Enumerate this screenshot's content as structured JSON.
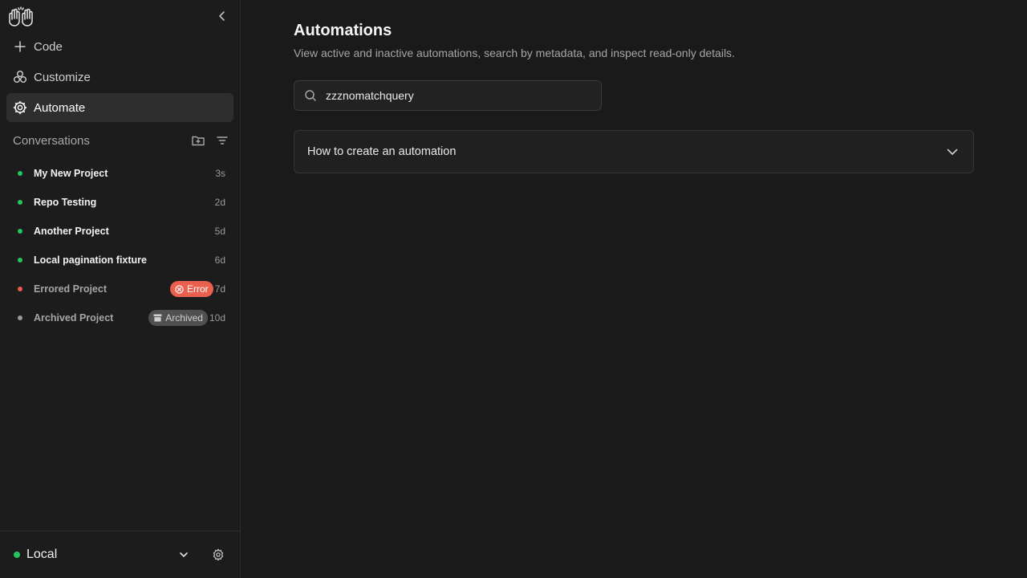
{
  "sidebar": {
    "nav": [
      {
        "label": "Code",
        "icon": "plus-icon",
        "active": false
      },
      {
        "label": "Customize",
        "icon": "customize-icon",
        "active": false
      },
      {
        "label": "Automate",
        "icon": "gear-icon",
        "active": true
      }
    ],
    "conversations_label": "Conversations",
    "conversations": [
      {
        "name": "My New Project",
        "time": "3s",
        "status": "active",
        "badge": null
      },
      {
        "name": "Repo Testing",
        "time": "2d",
        "status": "active",
        "badge": null
      },
      {
        "name": "Another Project",
        "time": "5d",
        "status": "active",
        "badge": null
      },
      {
        "name": "Local pagination fixture",
        "time": "6d",
        "status": "active",
        "badge": null
      },
      {
        "name": "Errored Project",
        "time": "7d",
        "status": "error",
        "badge": "Error"
      },
      {
        "name": "Archived Project",
        "time": "10d",
        "status": "archived",
        "badge": "Archived"
      }
    ],
    "footer": {
      "environment": "Local"
    }
  },
  "main": {
    "title": "Automations",
    "subtitle": "View active and inactive automations, search by metadata, and inspect read-only details.",
    "search": {
      "value": "zzznomatchquery",
      "placeholder": ""
    },
    "accordion": {
      "title": "How to create an automation",
      "expanded": false
    }
  },
  "colors": {
    "active_dot": "#22c55e",
    "error_dot": "#ef5b4d",
    "archived_dot": "#9a9a9a",
    "error_badge": "#e9604f",
    "archived_badge": "#505050",
    "active_nav_bg": "#2e2e2e"
  }
}
